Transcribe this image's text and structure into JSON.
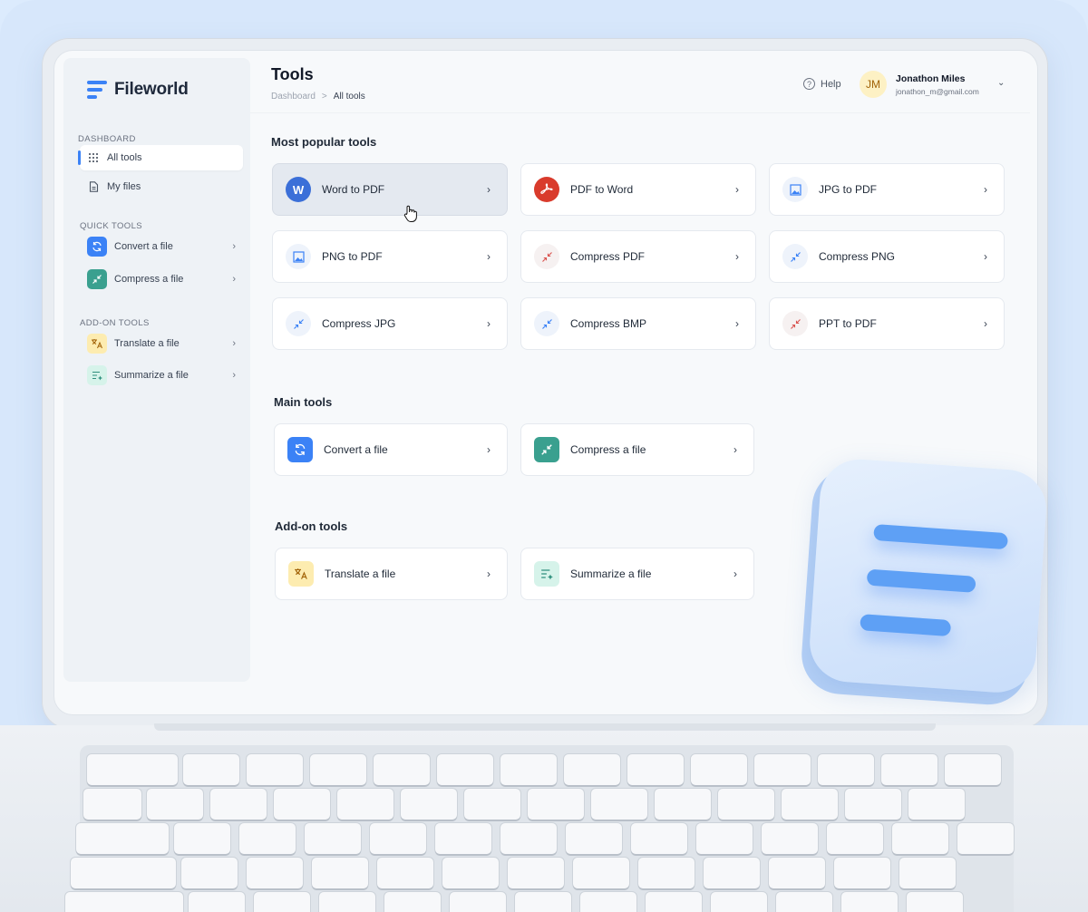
{
  "app": {
    "name": "Fileworld"
  },
  "sidebar": {
    "dashboard_label": "DASHBOARD",
    "dashboard_items": [
      {
        "label": "All tools",
        "icon": "grid-icon",
        "active": true
      },
      {
        "label": "My files",
        "icon": "file-icon"
      }
    ],
    "quick_label": "QUICK TOOLS",
    "quick_items": [
      {
        "label": "Convert a file",
        "icon": "convert-icon",
        "color": "#3b82f6"
      },
      {
        "label": "Compress a file",
        "icon": "compress-icon",
        "color": "#3aa08f"
      }
    ],
    "addon_label": "ADD-ON TOOLS",
    "addon_items": [
      {
        "label": "Translate a file",
        "icon": "translate-icon",
        "color": "#fdecb0"
      },
      {
        "label": "Summarize a file",
        "icon": "summarize-icon",
        "color": "#d6f3ea"
      }
    ]
  },
  "header": {
    "title": "Tools",
    "breadcrumb": [
      "Dashboard",
      ">",
      "All tools"
    ],
    "help_label": "Help",
    "user": {
      "initials": "JM",
      "name": "Jonathon Miles",
      "email": "jonathon_m@gmail.com"
    }
  },
  "popular": {
    "title": "Most popular tools",
    "tools": [
      {
        "label": "Word to PDF",
        "icon": "word-icon"
      },
      {
        "label": "PDF to Word",
        "icon": "acrobat-icon"
      },
      {
        "label": "JPG to PDF",
        "icon": "image-icon"
      },
      {
        "label": "PNG to PDF",
        "icon": "image-icon"
      },
      {
        "label": "Compress PDF",
        "icon": "compress-arrows-icon"
      },
      {
        "label": "Compress PNG",
        "icon": "compress-arrows-icon"
      },
      {
        "label": "Compress JPG",
        "icon": "compress-arrows-icon"
      },
      {
        "label": "Compress BMP",
        "icon": "compress-arrows-icon"
      },
      {
        "label": "PPT to PDF",
        "icon": "compress-arrows-icon"
      }
    ]
  },
  "main_tools": {
    "title": "Main tools",
    "tools": [
      {
        "label": "Convert a file",
        "icon": "convert-icon"
      },
      {
        "label": "Compress a file",
        "icon": "compress-icon"
      }
    ]
  },
  "addon_tools": {
    "title": "Add-on tools",
    "tools": [
      {
        "label": "Translate a file",
        "icon": "translate-icon"
      },
      {
        "label": "Summarize a file",
        "icon": "summarize-icon"
      }
    ]
  },
  "icons": {
    "word_letter": "W",
    "chevron": "›",
    "chevron_down": "⌄"
  },
  "colors": {
    "accent": "#3b82f6",
    "background": "#dcebfd"
  }
}
